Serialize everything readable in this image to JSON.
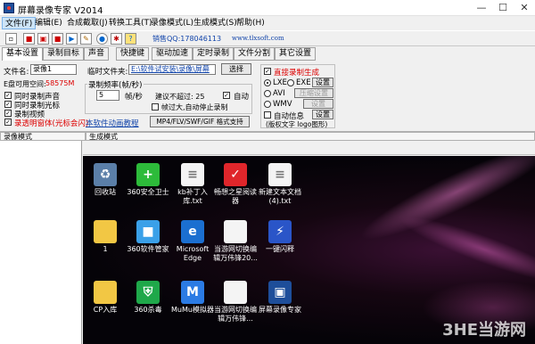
{
  "window": {
    "title": "屏幕录像专家 V2014",
    "minimize": "—",
    "maximize": "☐",
    "close": "✕"
  },
  "menu": [
    "文件(F)",
    "编辑(E)",
    "合成截取(J)",
    "转换工具(T)",
    "录像模式(L)",
    "生成模式(S)",
    "帮助(H)"
  ],
  "toolbar": {
    "sales_qq": "销售QQ:178046113",
    "website": "www.tlxsoft.com"
  },
  "tabs": [
    "基本设置",
    "录制目标",
    "声音",
    "快捷键",
    "驱动加速",
    "定时录制",
    "文件分割",
    "其它设置"
  ],
  "basic": {
    "filename_label": "文件名:",
    "filename_value": "录像1",
    "temp_folder_label": "临时文件夹:",
    "temp_folder_value": "E:\\软件试安装\\录像\\屏幕",
    "choose_button": "选择",
    "disk_free_label": "E盘可用空间:",
    "disk_free_value": "58575M",
    "rec_sound": "同时录制声音",
    "rec_cursor": "同时录制光标",
    "rec_video": "录制视频",
    "rec_transparent": "录透明窗体(光标会闪)",
    "tutorial_link": "本软件动画教程",
    "fps_group": "录制频率(帧/秒)",
    "fps_value": "5",
    "fps_unit": "帧/秒",
    "suggest": "建议不超过: 25",
    "auto": "自动",
    "auto_stop": "帧过大,自动停止录制",
    "format_button": "MP4/FLV/SWF/GIF 格式支持"
  },
  "output": {
    "direct_gen": "直接录制生成",
    "lxe": "LXE",
    "exe": "EXE",
    "settings_button": "设置",
    "avi": "AVI",
    "compress_settings": "压缩设置",
    "wmv": "WMV",
    "wmv_settings": "设置",
    "auto_info": "自动信息",
    "info_settings": "设置",
    "info_sub": "(版权文字 logo图形)"
  },
  "columns": {
    "recordings": "录像模式",
    "generate": "生成模式"
  },
  "desktop_icons": [
    {
      "label": "回收站",
      "icon": "recycle-bin-icon",
      "color": "#5b7fa8",
      "glyph": "♻"
    },
    {
      "label": "360安全卫士",
      "icon": "360-safe-icon",
      "color": "#2dbb3a",
      "glyph": "+"
    },
    {
      "label": "kb补丁入库.txt",
      "icon": "text-file-icon",
      "color": "#f4f4f4",
      "glyph": "≡"
    },
    {
      "label": "畅想之星阅读器",
      "icon": "reader-icon",
      "color": "#e0262b",
      "glyph": "✓"
    },
    {
      "label": "新建文本文档(4).txt",
      "icon": "text-file-icon",
      "color": "#f4f4f4",
      "glyph": "≡"
    },
    {
      "label": "1",
      "icon": "folder-icon",
      "color": "#f2c744",
      "glyph": ""
    },
    {
      "label": "360软件管家",
      "icon": "360-soft-icon",
      "color": "#3aa0e8",
      "glyph": "■"
    },
    {
      "label": "Microsoft Edge",
      "icon": "edge-icon",
      "color": "#1b6fd0",
      "glyph": "e"
    },
    {
      "label": "当游网切换编辑万伟锋20...",
      "icon": "document-icon",
      "color": "#f4f4f4",
      "glyph": ""
    },
    {
      "label": "一键闪释",
      "icon": "flash-icon",
      "color": "#2a55c8",
      "glyph": "⚡"
    },
    {
      "label": "CP入库",
      "icon": "folder-icon",
      "color": "#f2c744",
      "glyph": ""
    },
    {
      "label": "360杀毒",
      "icon": "360-av-icon",
      "color": "#1fa84a",
      "glyph": "⛨"
    },
    {
      "label": "MuMu模拟器",
      "icon": "mumu-icon",
      "color": "#2b7be4",
      "glyph": "M"
    },
    {
      "label": "当游网切换编辑万伟锋...",
      "icon": "document-icon",
      "color": "#f4f4f4",
      "glyph": ""
    },
    {
      "label": "屏幕录像专家",
      "icon": "screen-recorder-icon",
      "color": "#1e4e9a",
      "glyph": "▣"
    }
  ],
  "watermark": "3HE当游网"
}
